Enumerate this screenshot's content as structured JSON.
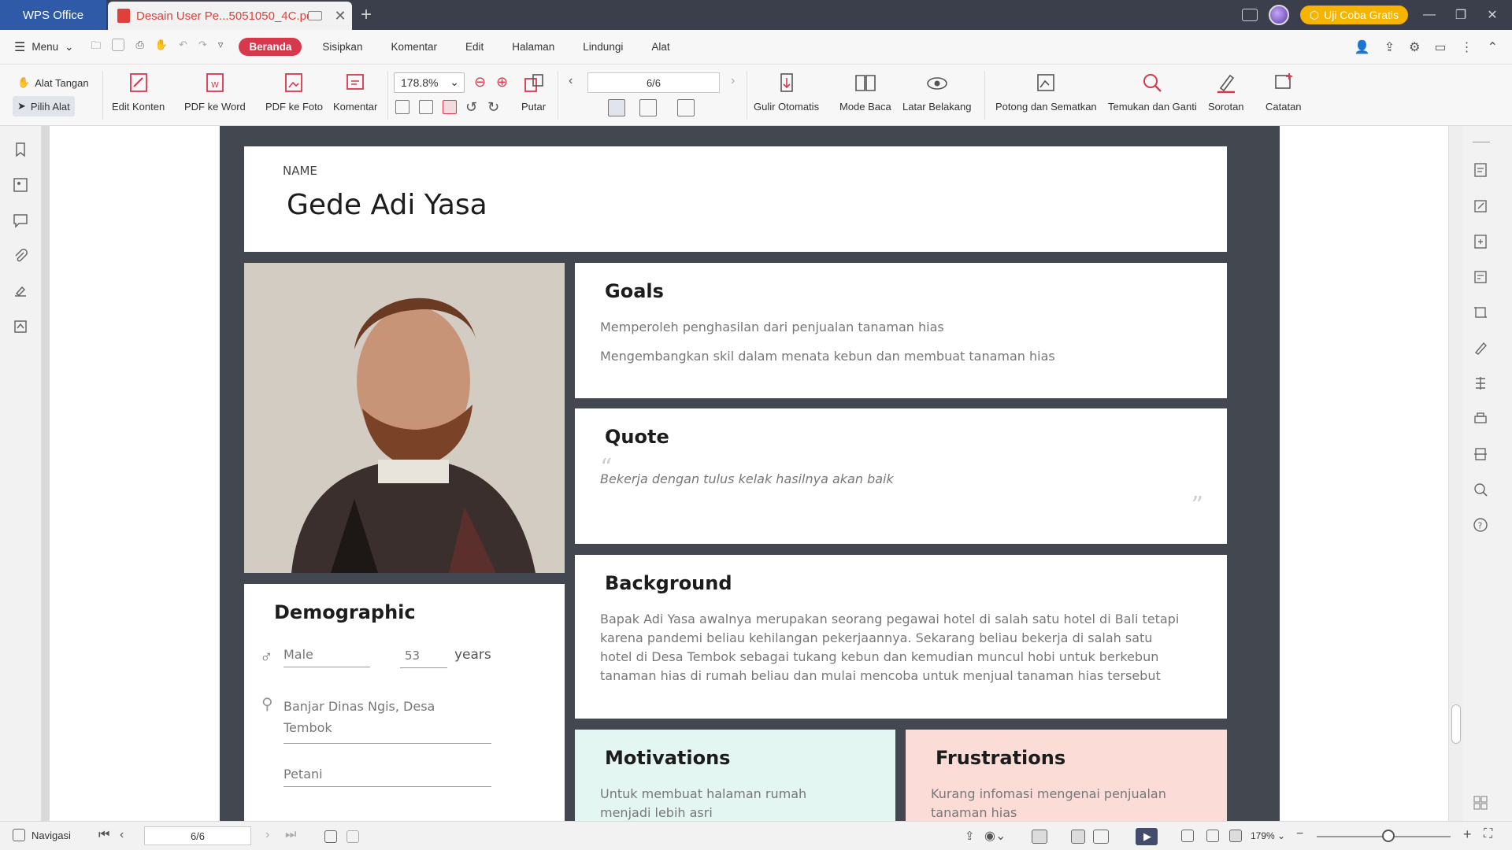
{
  "titlebar": {
    "app_tab": "WPS Office",
    "doc_tab": "Desain User Pe...5051050_4C.pdf",
    "trial_label": "Uji Coba Gratis"
  },
  "menubar": {
    "menu_label": "Menu",
    "tabs": [
      "Beranda",
      "Sisipkan",
      "Komentar",
      "Edit",
      "Halaman",
      "Lindungi",
      "Alat"
    ]
  },
  "toolbar": {
    "hand_tool": "Alat Tangan",
    "select_tool": "Pilih Alat",
    "edit_content": "Edit Konten",
    "pdf_to_word": "PDF ke Word",
    "pdf_to_photo": "PDF ke Foto",
    "comment": "Komentar",
    "zoom": "178.8%",
    "rotate": "Putar",
    "page_indicator": "6/6",
    "auto_scroll": "Gulir Otomatis",
    "read_mode": "Mode Baca",
    "background": "Latar Belakang",
    "crop": "Potong dan Sematkan",
    "find_replace": "Temukan dan Ganti",
    "highlight": "Sorotan",
    "notes": "Catatan"
  },
  "document": {
    "name_label": "NAME",
    "name": "Gede Adi Yasa",
    "goals": {
      "title": "Goals",
      "items": [
        "Memperoleh penghasilan dari penjualan tanaman hias",
        "Mengembangkan skil dalam menata kebun dan membuat tanaman hias"
      ]
    },
    "quote": {
      "title": "Quote",
      "text": "Bekerja dengan tulus kelak hasilnya akan baik"
    },
    "background": {
      "title": "Background",
      "lines": [
        "Bapak Adi Yasa awalnya merupakan seorang pegawai hotel di salah satu hotel di Bali tetapi",
        "karena pandemi beliau kehilangan pekerjaannya. Sekarang beliau bekerja di salah satu",
        "hotel di Desa Tembok sebagai tukang kebun dan kemudian muncul hobi untuk berkebun",
        "tanaman hias di rumah beliau dan mulai mencoba untuk menjual tanaman hias tersebut"
      ]
    },
    "demographic": {
      "title": "Demographic",
      "gender": "Male",
      "age": "53",
      "age_unit": "years",
      "address_line1": "Banjar Dinas Ngis, Desa",
      "address_line2": "Tembok",
      "occupation": "Petani"
    },
    "motivations": {
      "title": "Motivations",
      "line1": "Untuk membuat halaman rumah",
      "line2": "menjadi lebih asri"
    },
    "frustrations": {
      "title": "Frustrations",
      "line1": "Kurang infomasi mengenai penjualan",
      "line2": "tanaman hias"
    }
  },
  "statusbar": {
    "nav_label": "Navigasi",
    "page": "6/6",
    "zoom": "179%"
  },
  "colors": {
    "brand_blue": "#2f5aa8",
    "active_tab": "#d8384c",
    "sheet_bg": "#434850",
    "motivations_bg": "#e4f6f1",
    "frustrations_bg": "#fbdcd7"
  }
}
